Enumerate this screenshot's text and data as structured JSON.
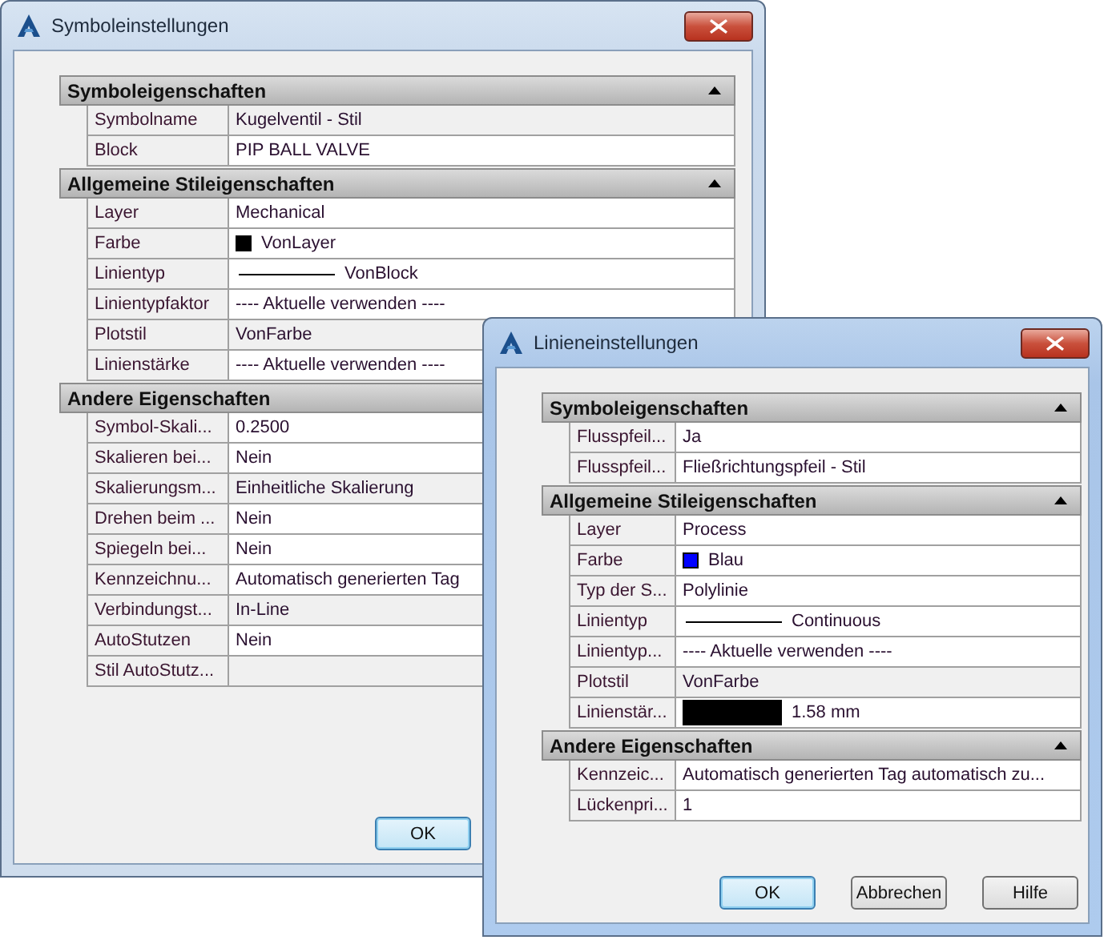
{
  "windows": [
    {
      "title": "Symboleinstellungen",
      "active": false,
      "sections": [
        {
          "title": "Symboleigenschaften",
          "expanded": true,
          "rows": [
            {
              "label": "Symbolname",
              "value": "Kugelventil - Stil",
              "kind": "text",
              "readonly": true
            },
            {
              "label": "Block",
              "value": "PIP BALL VALVE",
              "kind": "text",
              "readonly": false
            }
          ]
        },
        {
          "title": "Allgemeine Stileigenschaften",
          "expanded": true,
          "rows": [
            {
              "label": "Layer",
              "value": "Mechanical",
              "kind": "text",
              "readonly": false
            },
            {
              "label": "Farbe",
              "value": "VonLayer",
              "kind": "color",
              "color": "#000000",
              "readonly": false
            },
            {
              "label": "Linientyp",
              "value": "VonBlock",
              "kind": "linetype",
              "readonly": false
            },
            {
              "label": "Linientypfaktor",
              "value": "---- Aktuelle verwenden ----",
              "kind": "text",
              "readonly": false
            },
            {
              "label": "Plotstil",
              "value": "VonFarbe",
              "kind": "text",
              "readonly": true
            },
            {
              "label": "Linienstärke",
              "value": "---- Aktuelle verwenden ----",
              "kind": "text",
              "readonly": false
            }
          ]
        },
        {
          "title": "Andere Eigenschaften",
          "expanded": true,
          "rows": [
            {
              "label": "Symbol-Skali...",
              "value": "0.2500",
              "kind": "text",
              "readonly": false
            },
            {
              "label": "Skalieren bei...",
              "value": "Nein",
              "kind": "text",
              "readonly": false
            },
            {
              "label": "Skalierungsm...",
              "value": "Einheitliche Skalierung",
              "kind": "text",
              "readonly": true
            },
            {
              "label": "Drehen beim ...",
              "value": "Nein",
              "kind": "text",
              "readonly": false
            },
            {
              "label": "Spiegeln bei...",
              "value": "Nein",
              "kind": "text",
              "readonly": false
            },
            {
              "label": "Kennzeichnu...",
              "value": "Automatisch generierten Tag",
              "kind": "text",
              "readonly": false
            },
            {
              "label": "Verbindungst...",
              "value": "In-Line",
              "kind": "text",
              "readonly": true
            },
            {
              "label": "AutoStutzen",
              "value": "Nein",
              "kind": "text",
              "readonly": false
            },
            {
              "label": "Stil AutoStutz...",
              "kind": "text",
              "readonly": true
            }
          ]
        }
      ],
      "buttons": [
        {
          "label": "OK",
          "default": true
        }
      ]
    },
    {
      "title": "Linieneinstellungen",
      "active": true,
      "sections": [
        {
          "title": "Symboleigenschaften",
          "expanded": true,
          "rows": [
            {
              "label": "Flusspfeil...",
              "value": "Ja",
              "kind": "text",
              "readonly": false
            },
            {
              "label": "Flusspfeil...",
              "value": "Fließrichtungspfeil - Stil",
              "kind": "text",
              "readonly": false
            }
          ]
        },
        {
          "title": "Allgemeine Stileigenschaften",
          "expanded": true,
          "rows": [
            {
              "label": "Layer",
              "value": "Process",
              "kind": "text",
              "readonly": false
            },
            {
              "label": "Farbe",
              "value": "Blau",
              "kind": "color",
              "color": "#0000ff",
              "readonly": false
            },
            {
              "label": "Typ der S...",
              "value": "Polylinie",
              "kind": "text",
              "readonly": false
            },
            {
              "label": "Linientyp",
              "value": "Continuous",
              "kind": "linetype",
              "readonly": false
            },
            {
              "label": "Linientyp...",
              "value": "---- Aktuelle verwenden ----",
              "kind": "text",
              "readonly": false
            },
            {
              "label": "Plotstil",
              "value": "VonFarbe",
              "kind": "text",
              "readonly": true
            },
            {
              "label": "Linienstär...",
              "value": "1.58 mm",
              "kind": "lineweight",
              "readonly": false
            }
          ]
        },
        {
          "title": "Andere Eigenschaften",
          "expanded": true,
          "rows": [
            {
              "label": "Kennzeic...",
              "value": "Automatisch generierten Tag automatisch zu...",
              "kind": "text",
              "readonly": false
            },
            {
              "label": "Lückenpri...",
              "value": "1",
              "kind": "text",
              "readonly": false
            }
          ]
        }
      ],
      "buttons": [
        {
          "label": "OK",
          "default": true
        },
        {
          "label": "Abbrechen",
          "default": false
        },
        {
          "label": "Hilfe",
          "default": false
        }
      ]
    }
  ]
}
